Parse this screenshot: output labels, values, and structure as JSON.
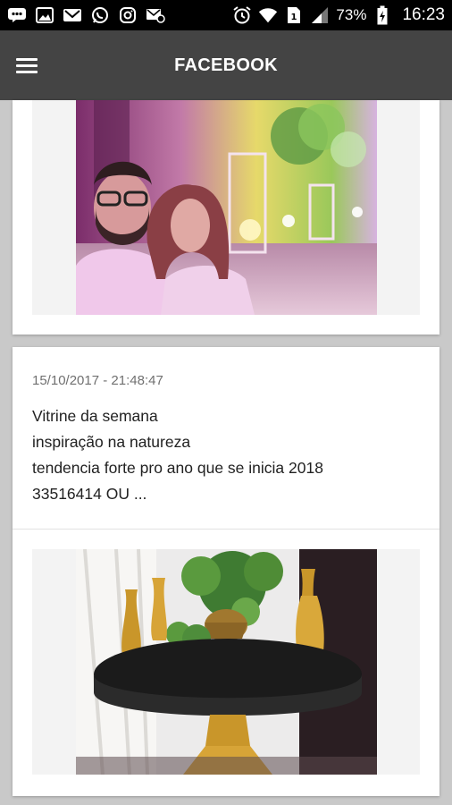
{
  "status_bar": {
    "battery_percent": "73%",
    "time": "16:23",
    "left_icons": [
      "bbm-icon",
      "gallery-icon",
      "gmail-icon",
      "whatsapp-icon",
      "instagram-icon",
      "email-sync-icon"
    ],
    "right_icons": [
      "alarm-icon",
      "wifi-icon",
      "sim-icon",
      "signal-icon",
      "battery-icon"
    ]
  },
  "app_bar": {
    "title": "FACEBOOK",
    "menu_icon": "hamburger-menu-icon",
    "background": "#444444"
  },
  "feed": {
    "posts": [
      {
        "image_description_icon": "photo",
        "has_image": true
      },
      {
        "date": "15/10/2017 - 21:48:47",
        "text_lines": [
          "Vitrine da semana",
          "inspiração na natureza",
          "tendencia forte pro ano que se inicia 2018",
          "33516414 OU ..."
        ],
        "has_image": true
      }
    ]
  },
  "colors": {
    "page_background": "#c9c9c9",
    "card_background": "#ffffff",
    "status_bar": "#000000"
  }
}
